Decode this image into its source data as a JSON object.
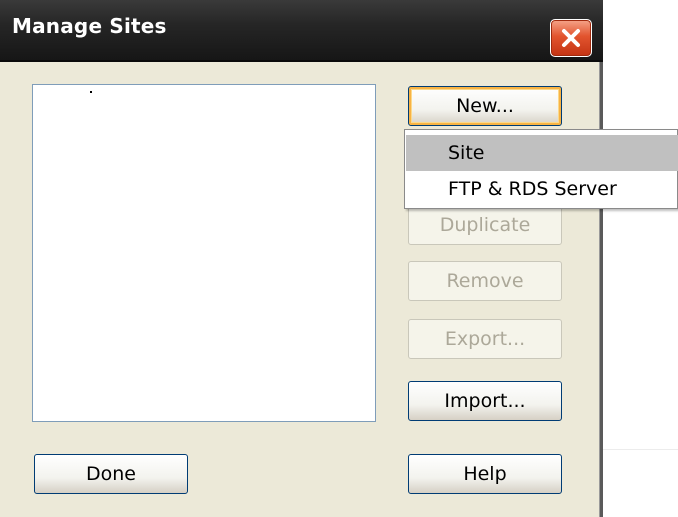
{
  "window": {
    "title": "Manage Sites",
    "close_icon": "close-icon",
    "accent_close": "#e2542e"
  },
  "buttons": {
    "new": "New...",
    "duplicate": "Duplicate",
    "remove": "Remove",
    "export": "Export...",
    "import": "Import...",
    "done": "Done",
    "help": "Help"
  },
  "new_menu": {
    "items": [
      {
        "label": "Site",
        "highlighted": true
      },
      {
        "label": "FTP & RDS Server",
        "highlighted": false
      }
    ]
  },
  "site_list": {
    "items": []
  }
}
